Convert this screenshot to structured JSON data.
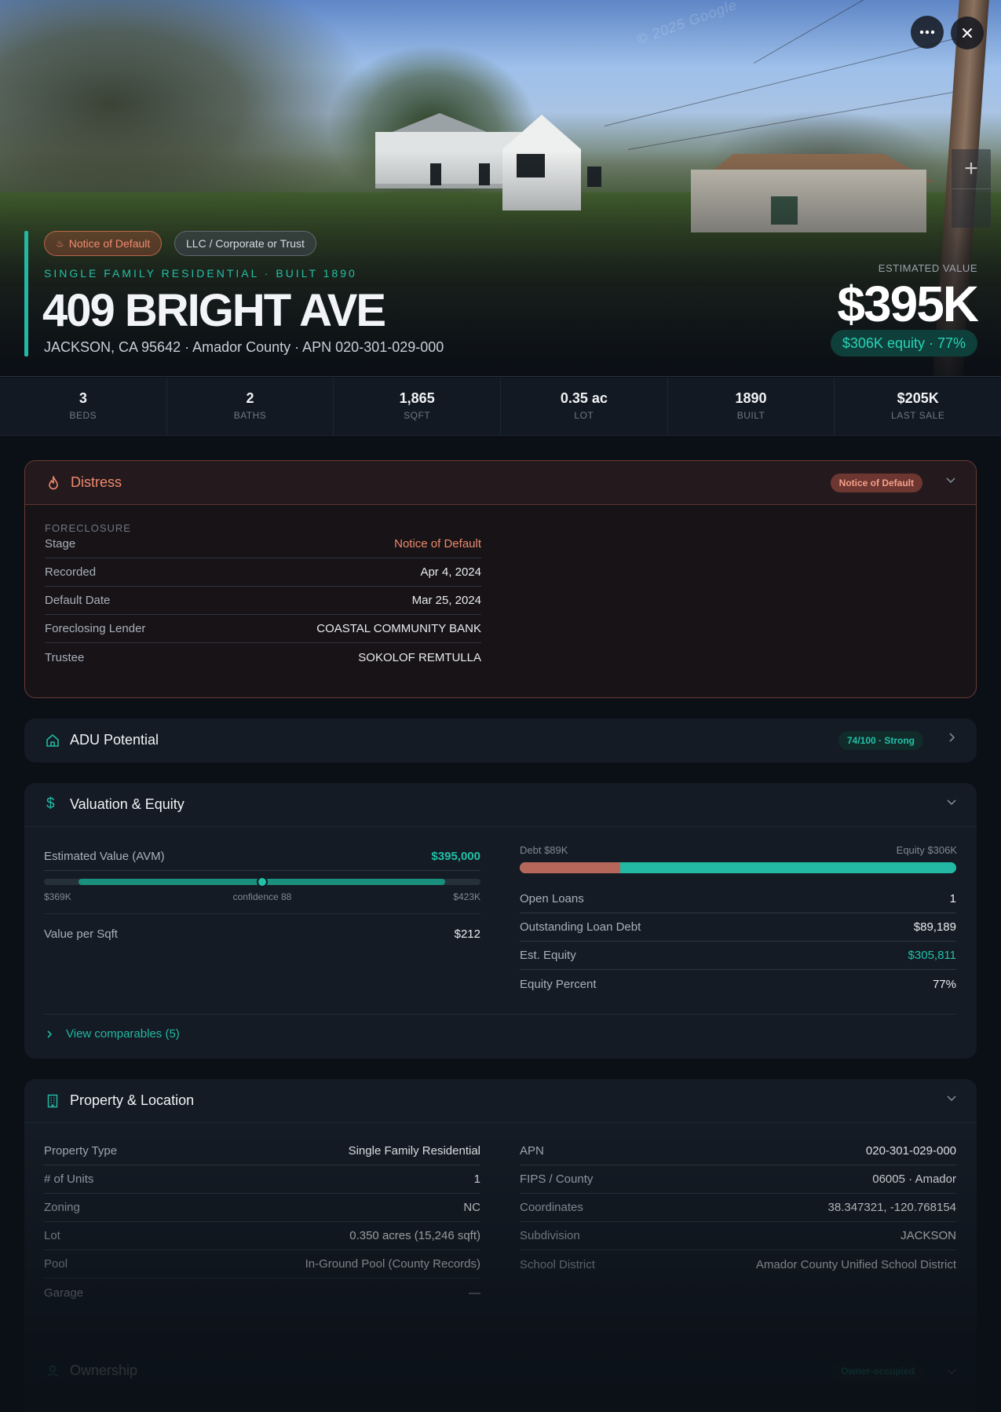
{
  "hero": {
    "watermark": "© 2025 Google",
    "chips": {
      "distress": "Notice of Default",
      "owner_type": "LLC / Corporate or Trust"
    },
    "subtype": "SINGLE FAMILY RESIDENTIAL · BUILT 1890",
    "address": "409 BRIGHT AVE",
    "city_line": "JACKSON, CA 95642 · Amador County · APN 020-301-029-000",
    "est_label": "ESTIMATED VALUE",
    "est_value": "$395K",
    "equity_pill": "$306K equity · 77%",
    "more_icon": "ellipsis-icon",
    "close_icon": "close-icon",
    "zoom_in": "+",
    "zoom_out": ""
  },
  "stats": [
    {
      "value": "3",
      "label": "BEDS"
    },
    {
      "value": "2",
      "label": "BATHS"
    },
    {
      "value": "1,865",
      "label": "SQFT"
    },
    {
      "value": "0.35 ac",
      "label": "LOT"
    },
    {
      "value": "1890",
      "label": "BUILT"
    },
    {
      "value": "$205K",
      "label": "LAST SALE"
    }
  ],
  "distress": {
    "title": "Distress",
    "badge": "Notice of Default",
    "section": "FORECLOSURE",
    "rows": [
      {
        "k": "Stage",
        "v": "Notice of Default"
      },
      {
        "k": "Recorded",
        "v": "Apr 4, 2024"
      },
      {
        "k": "Default Date",
        "v": "Mar 25, 2024"
      },
      {
        "k": "Foreclosing Lender",
        "v": "COASTAL COMMUNITY BANK"
      },
      {
        "k": "Trustee",
        "v": "SOKOLOF REMTULLA"
      }
    ],
    "accent_color": "#f08a6e"
  },
  "adu": {
    "title": "ADU Potential",
    "badge": "74/100 · Strong"
  },
  "valuation": {
    "title": "Valuation & Equity",
    "avm_label": "Estimated Value (AVM)",
    "avm_value": "$395,000",
    "range_low": "$369K",
    "range_high": "$423K",
    "confidence": "confidence 88",
    "range_marker_fraction": 0.5,
    "vps_label": "Value per Sqft",
    "vps_value": "$212",
    "debt_label": "Debt $89K",
    "equity_label": "Equity $306K",
    "debt_fraction": 0.23,
    "rows": [
      {
        "k": "Open Loans",
        "v": "1"
      },
      {
        "k": "Outstanding Loan Debt",
        "v": "$89,189"
      },
      {
        "k": "Est. Equity",
        "v": "$305,811"
      },
      {
        "k": "Equity Percent",
        "v": "77%"
      }
    ],
    "comparables": "View comparables (5)",
    "accent_color": "#22b8a3",
    "debt_color": "#b5675a"
  },
  "property": {
    "title": "Property & Location",
    "left": [
      {
        "k": "Property Type",
        "v": "Single Family Residential"
      },
      {
        "k": "# of Units",
        "v": "1"
      },
      {
        "k": "Zoning",
        "v": "NC"
      },
      {
        "k": "Lot",
        "v": "0.350 acres (15,246 sqft)"
      },
      {
        "k": "Pool",
        "v": "In-Ground Pool (County Records)"
      },
      {
        "k": "Garage",
        "v": "—"
      }
    ],
    "right": [
      {
        "k": "APN",
        "v": "020-301-029-000"
      },
      {
        "k": "FIPS / County",
        "v": "06005 · Amador"
      },
      {
        "k": "Coordinates",
        "v": "38.347321, -120.768154"
      },
      {
        "k": "Subdivision",
        "v": "JACKSON"
      },
      {
        "k": "School District",
        "v": "Amador County Unified School District"
      }
    ]
  },
  "ownership": {
    "title": "Ownership",
    "badge": "Owner-occupied"
  }
}
